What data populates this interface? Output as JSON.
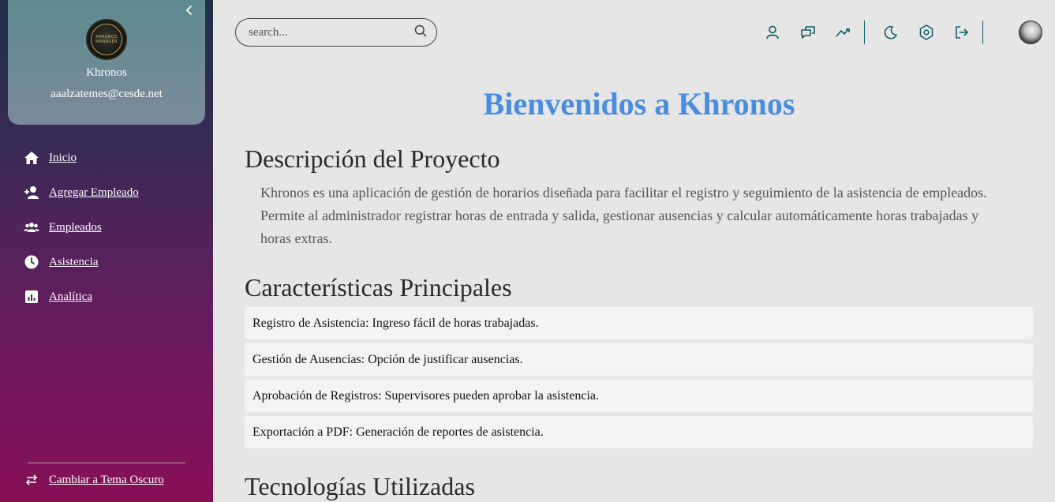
{
  "sidebar": {
    "collapse_icon": "chevron-left-icon",
    "logo_text": [
      "KHRONOS",
      "MANAGER"
    ],
    "profile_name": "Khronos",
    "profile_email": "aaalzatemes@cesde.net",
    "items": [
      {
        "label": "Inicio",
        "icon": "home-icon"
      },
      {
        "label": "Agregar Empleado",
        "icon": "user-plus-icon"
      },
      {
        "label": "Empleados",
        "icon": "users-icon"
      },
      {
        "label": "Asistencia",
        "icon": "clock-icon"
      },
      {
        "label": "Analítica",
        "icon": "chart-icon"
      }
    ],
    "theme_toggle_label": "Cambiar a Tema Oscuro"
  },
  "header": {
    "search_placeholder": "search...",
    "icons": [
      "user-icon",
      "messages-icon",
      "trend-icon",
      "moon-icon",
      "settings-icon",
      "logout-icon"
    ]
  },
  "main": {
    "title": "Bienvenidos a Khronos",
    "description_heading": "Descripción del Proyecto",
    "description": "Khronos es una aplicación de gestión de horarios diseñada para facilitar el registro y seguimiento de la asistencia de empleados. Permite al administrador registrar horas de entrada y salida, gestionar ausencias y calcular automáticamente horas trabajadas y horas extras.",
    "features_heading": "Características Principales",
    "features": [
      "Registro de Asistencia: Ingreso fácil de horas trabajadas.",
      "Gestión de Ausencias: Opción de justificar ausencias.",
      "Aprobación de Registros: Supervisores pueden aprobar la asistencia.",
      "Exportación a PDF: Generación de reportes de asistencia."
    ],
    "tech_heading": "Tecnologías Utilizadas"
  },
  "colors": {
    "accent": "#4a8de0",
    "icon_teal": "#0f5f6a"
  }
}
